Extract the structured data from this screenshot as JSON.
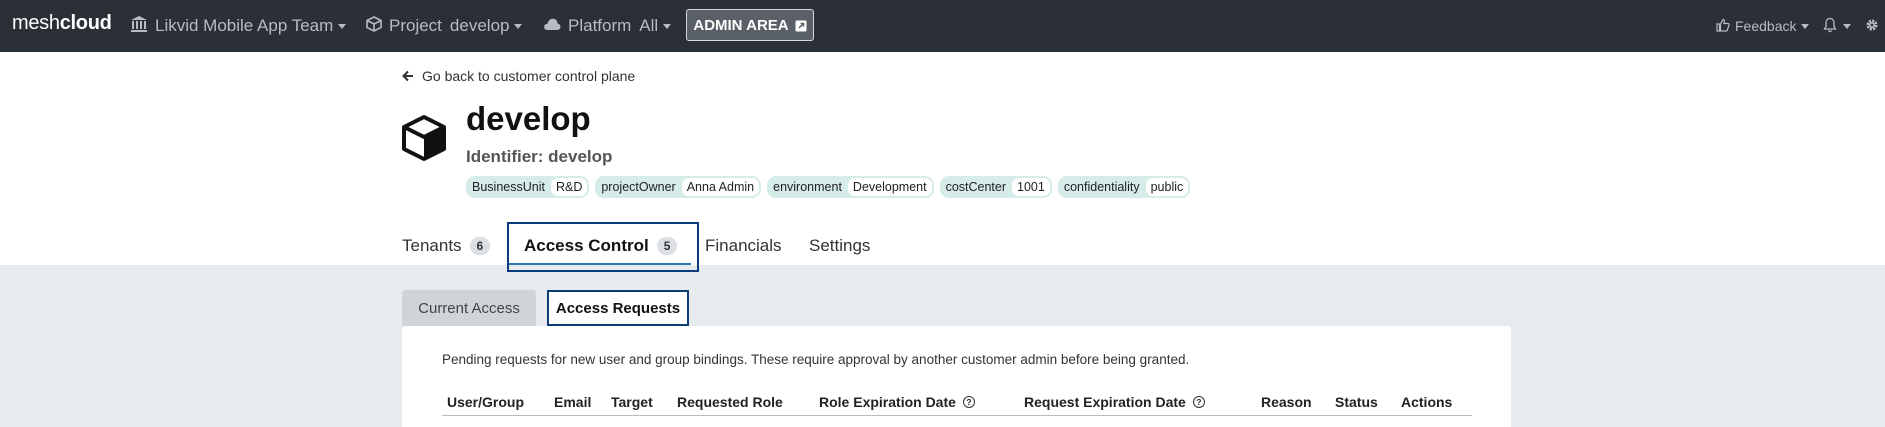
{
  "navbar": {
    "brand_light": "mesh",
    "brand_bold": "cloud",
    "workspace": "Likvid Mobile App Team",
    "project_label": "Project",
    "project_value": "develop",
    "platform_label": "Platform",
    "platform_value": "All",
    "admin_area": "ADMIN AREA",
    "feedback": "Feedback"
  },
  "header": {
    "back_link": "Go back to customer control plane",
    "title": "develop",
    "identifier": "Identifier: develop",
    "tags": [
      {
        "key": "BusinessUnit",
        "value": "R&D"
      },
      {
        "key": "projectOwner",
        "value": "Anna Admin"
      },
      {
        "key": "environment",
        "value": "Development"
      },
      {
        "key": "costCenter",
        "value": "1001"
      },
      {
        "key": "confidentiality",
        "value": "public"
      }
    ]
  },
  "tabs": [
    {
      "label": "Tenants",
      "count": "6"
    },
    {
      "label": "Access Control",
      "count": "5"
    },
    {
      "label": "Financials"
    },
    {
      "label": "Settings"
    }
  ],
  "subtabs": {
    "current_access": "Current Access",
    "access_requests": "Access Requests"
  },
  "panel": {
    "description": "Pending requests for new user and group bindings. These require approval by another customer admin before being granted.",
    "columns": [
      "User/Group",
      "Email",
      "Target",
      "Requested Role",
      "Role Expiration Date",
      "Request Expiration Date",
      "Reason",
      "Status",
      "Actions"
    ]
  }
}
